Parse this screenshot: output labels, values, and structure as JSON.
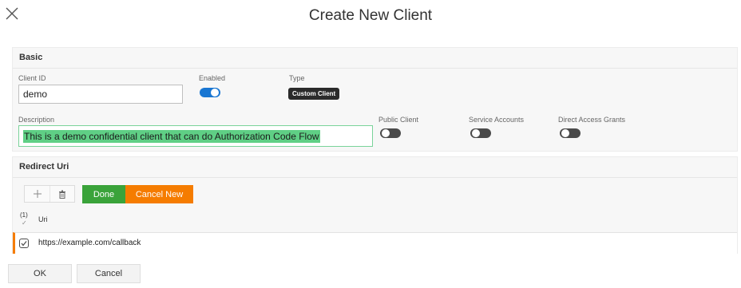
{
  "dialog": {
    "title": "Create New Client",
    "close_icon": "close-icon"
  },
  "basic": {
    "header": "Basic",
    "client_id": {
      "label": "Client ID",
      "value": "demo"
    },
    "enabled": {
      "label": "Enabled",
      "on": true
    },
    "type": {
      "label": "Type",
      "value": "Custom Client"
    },
    "description": {
      "label": "Description",
      "value": "This is a demo confidential client that can do Authorization Code Flow"
    },
    "public_client": {
      "label": "Public Client",
      "on": false
    },
    "service_accounts": {
      "label": "Service Accounts",
      "on": false
    },
    "direct_access_grants": {
      "label": "Direct Access Grants",
      "on": false
    }
  },
  "redirect": {
    "header": "Redirect Uri",
    "toolbar": {
      "add_icon": "plus-icon",
      "delete_icon": "trash-icon",
      "done_label": "Done",
      "cancel_new_label": "Cancel New"
    },
    "selected_count": "(1)",
    "selected_mark": "✓",
    "columns": [
      "Uri"
    ],
    "rows": [
      {
        "uri": "https://example.com/callback",
        "checked": true
      }
    ]
  },
  "footer": {
    "ok_label": "OK",
    "cancel_label": "Cancel"
  },
  "colors": {
    "toggle_on": "#1976d2",
    "done": "#3aa33a",
    "cancel_new": "#f57c00",
    "selection": "#5fcf85"
  }
}
